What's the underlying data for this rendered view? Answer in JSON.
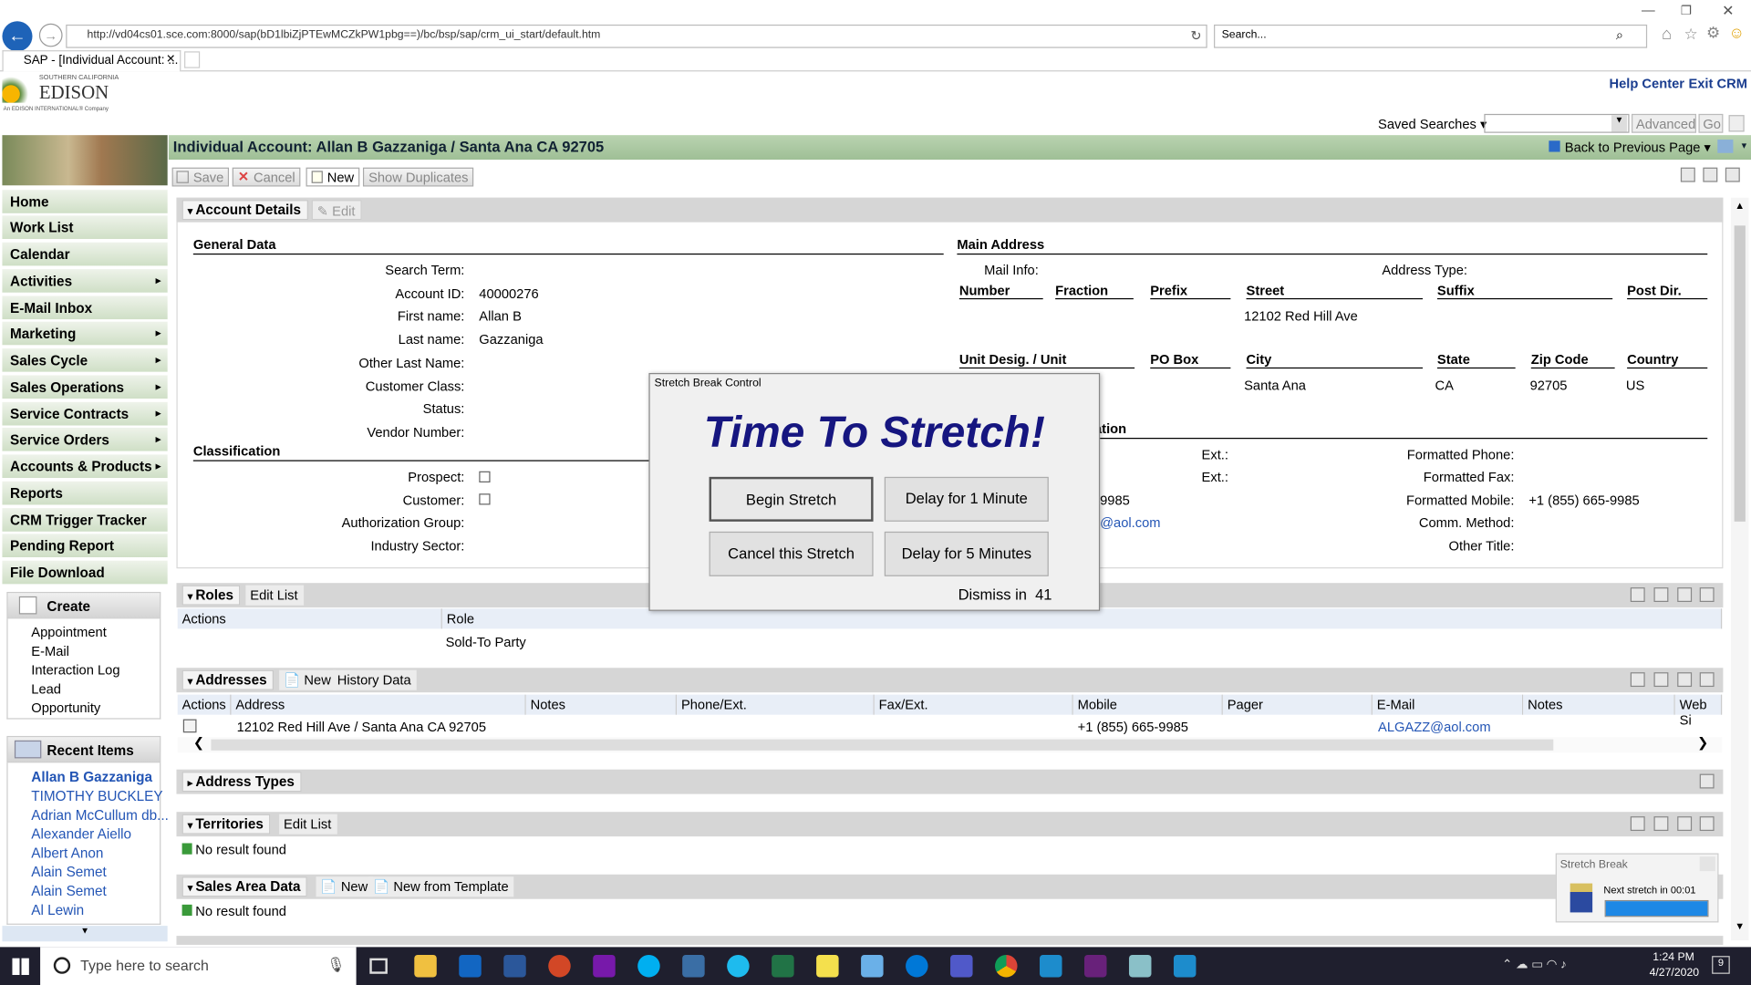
{
  "browser": {
    "url": "http://vd04cs01.sce.com:8000/sap(bD1lbiZjPTEwMCZkPW1pbg==)/bc/bsp/sap/crm_ui_start/default.htm",
    "search_placeholder": "Search...",
    "tab_title": "SAP - [Individual Account: ..."
  },
  "header": {
    "logo_line1": "SOUTHERN CALIFORNIA",
    "logo_line2": "EDISON",
    "logo_line3": "An EDISON INTERNATIONAL® Company",
    "help_center": "Help Center",
    "exit_crm": "Exit CRM",
    "saved_searches": "Saved Searches",
    "advanced": "Advanced",
    "go": "Go"
  },
  "page": {
    "title": "Individual Account: Allan B Gazzaniga / Santa Ana CA 92705",
    "back_link": "Back to Previous Page"
  },
  "toolbar": {
    "save": "Save",
    "cancel": "Cancel",
    "new": "New",
    "show_duplicates": "Show Duplicates"
  },
  "nav": {
    "items": [
      {
        "label": "Home",
        "arrow": ""
      },
      {
        "label": "Work List",
        "arrow": ""
      },
      {
        "label": "Calendar",
        "arrow": ""
      },
      {
        "label": "Activities",
        "arrow": "▸"
      },
      {
        "label": "E-Mail Inbox",
        "arrow": ""
      },
      {
        "label": "Marketing",
        "arrow": "▸"
      },
      {
        "label": "Sales Cycle",
        "arrow": "▸"
      },
      {
        "label": "Sales Operations",
        "arrow": "▸"
      },
      {
        "label": "Service Contracts",
        "arrow": "▸"
      },
      {
        "label": "Service Orders",
        "arrow": "▸"
      },
      {
        "label": "Accounts & Products",
        "arrow": "▸"
      },
      {
        "label": "Reports",
        "arrow": ""
      },
      {
        "label": "CRM Trigger Tracker",
        "arrow": ""
      },
      {
        "label": "Pending Report",
        "arrow": ""
      },
      {
        "label": "File Download",
        "arrow": ""
      }
    ],
    "create_title": "Create",
    "create_items": [
      "Appointment",
      "E-Mail",
      "Interaction Log",
      "Lead",
      "Opportunity"
    ],
    "recent_title": "Recent Items",
    "recent_items": [
      "Allan B Gazzaniga",
      "TIMOTHY BUCKLEY",
      "Adrian McCullum db...",
      "Alexander Aiello",
      "Albert Anon",
      "Alain Semet",
      "Alain Semet",
      "Al Lewin"
    ]
  },
  "account": {
    "section_title": "Account Details",
    "edit": "Edit",
    "general_data": "General Data",
    "fields": [
      {
        "label": "Search Term:",
        "value": ""
      },
      {
        "label": "Account ID:",
        "value": "40000276"
      },
      {
        "label": "First name:",
        "value": "Allan B"
      },
      {
        "label": "Last name:",
        "value": "Gazzaniga"
      },
      {
        "label": "Other Last Name:",
        "value": ""
      },
      {
        "label": "Customer Class:",
        "value": ""
      },
      {
        "label": "Status:",
        "value": ""
      },
      {
        "label": "Vendor Number:",
        "value": ""
      }
    ],
    "classification": "Classification",
    "class_fields": [
      "Prospect:",
      "Customer:",
      "Authorization Group:",
      "Industry Sector:"
    ],
    "main_address": "Main Address",
    "mail_info": "Mail Info:",
    "address_type": "Address Type:",
    "addr_cols1": [
      "Number",
      "Fraction",
      "Prefix",
      "Street",
      "Suffix",
      "Post Dir."
    ],
    "street": "12102 Red Hill Ave",
    "addr_cols2": [
      "Unit Desig. / Unit",
      "PO Box",
      "City",
      "State",
      "Zip Code",
      "Country"
    ],
    "city": "Santa Ana",
    "state": "CA",
    "zip": "92705",
    "country": "US",
    "comm_partial": "ation",
    "ext1": "Ext.:",
    "ext2": "Ext.:",
    "formatted_phone": "Formatted Phone:",
    "formatted_fax": "Formatted Fax:",
    "formatted_mobile": "Formatted Mobile:",
    "mobile_value": "+1 (855) 665-9985",
    "mobile_partial": "9985",
    "email_partial": "@aol.com",
    "comm_method": "Comm. Method:",
    "other_title": "Other Title:"
  },
  "roles": {
    "title": "Roles",
    "edit_list": "Edit List",
    "col_actions": "Actions",
    "col_role": "Role",
    "row_role": "Sold-To Party"
  },
  "addresses": {
    "title": "Addresses",
    "new": "New",
    "history": "History Data",
    "cols": [
      "Actions",
      "Address",
      "Notes",
      "Phone/Ext.",
      "Fax/Ext.",
      "Mobile",
      "Pager",
      "E-Mail",
      "Notes",
      "Web Si"
    ],
    "row": {
      "address": "12102 Red Hill Ave / Santa Ana CA 92705",
      "mobile": "+1 (855) 665-9985",
      "email": "ALGAZZ@aol.com"
    }
  },
  "address_types": {
    "title": "Address Types"
  },
  "territories": {
    "title": "Territories",
    "edit_list": "Edit List",
    "empty": "No result found"
  },
  "sales_area": {
    "title": "Sales Area Data",
    "new": "New",
    "new_template": "New from Template",
    "empty": "No result found"
  },
  "popup": {
    "title": "Stretch Break Control",
    "header": "Time To Stretch!",
    "begin": "Begin Stretch",
    "delay1": "Delay for 1 Minute",
    "cancel": "Cancel this Stretch",
    "delay5": "Delay for 5 Minutes",
    "dismiss": "Dismiss in  41"
  },
  "toast": {
    "title": "Stretch Break",
    "text": "Next stretch in 00:01",
    "progress": 1.0
  },
  "taskbar": {
    "search": "Type here to search",
    "time": "1:24 PM",
    "date": "4/27/2020",
    "notif": "9"
  },
  "colors": {
    "nav_green": "#cfdfc6",
    "title_green": "#9fbf96",
    "link_blue": "#2355b5",
    "popup_header": "#161680",
    "taskbar": "#1f1f2e"
  }
}
